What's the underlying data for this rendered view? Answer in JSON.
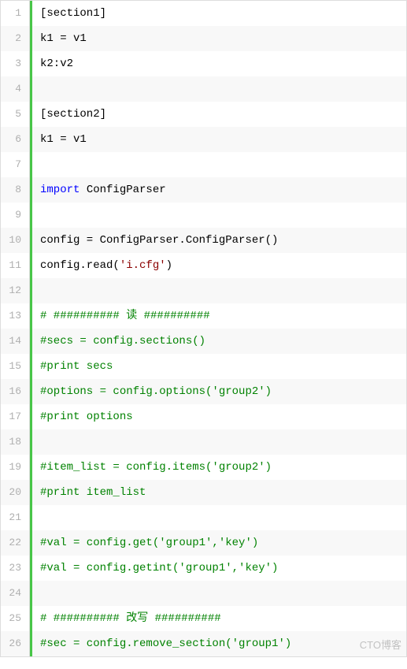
{
  "lines": [
    {
      "n": 1,
      "tokens": [
        {
          "cls": "plain",
          "t": "[section1]"
        }
      ]
    },
    {
      "n": 2,
      "tokens": [
        {
          "cls": "plain",
          "t": "k1 = v1"
        }
      ]
    },
    {
      "n": 3,
      "tokens": [
        {
          "cls": "plain",
          "t": "k2:v2"
        }
      ]
    },
    {
      "n": 4,
      "tokens": [
        {
          "cls": "plain",
          "t": ""
        }
      ]
    },
    {
      "n": 5,
      "tokens": [
        {
          "cls": "plain",
          "t": "[section2]"
        }
      ]
    },
    {
      "n": 6,
      "tokens": [
        {
          "cls": "plain",
          "t": "k1 = v1"
        }
      ]
    },
    {
      "n": 7,
      "tokens": [
        {
          "cls": "plain",
          "t": ""
        }
      ]
    },
    {
      "n": 8,
      "tokens": [
        {
          "cls": "tok-kw",
          "t": "import"
        },
        {
          "cls": "plain",
          "t": " ConfigParser"
        }
      ]
    },
    {
      "n": 9,
      "tokens": [
        {
          "cls": "plain",
          "t": ""
        }
      ]
    },
    {
      "n": 10,
      "tokens": [
        {
          "cls": "plain",
          "t": "config = ConfigParser.ConfigParser()"
        }
      ]
    },
    {
      "n": 11,
      "tokens": [
        {
          "cls": "plain",
          "t": "config.read("
        },
        {
          "cls": "tok-str",
          "t": "'i.cfg'"
        },
        {
          "cls": "plain",
          "t": ")"
        }
      ]
    },
    {
      "n": 12,
      "tokens": [
        {
          "cls": "plain",
          "t": ""
        }
      ]
    },
    {
      "n": 13,
      "tokens": [
        {
          "cls": "tok-comment",
          "t": "# ########## 读 ##########"
        }
      ]
    },
    {
      "n": 14,
      "tokens": [
        {
          "cls": "tok-comment",
          "t": "#secs = config.sections()"
        }
      ]
    },
    {
      "n": 15,
      "tokens": [
        {
          "cls": "tok-comment",
          "t": "#print secs"
        }
      ]
    },
    {
      "n": 16,
      "tokens": [
        {
          "cls": "tok-comment",
          "t": "#options = config.options('group2')"
        }
      ]
    },
    {
      "n": 17,
      "tokens": [
        {
          "cls": "tok-comment",
          "t": "#print options"
        }
      ]
    },
    {
      "n": 18,
      "tokens": [
        {
          "cls": "plain",
          "t": ""
        }
      ]
    },
    {
      "n": 19,
      "tokens": [
        {
          "cls": "tok-comment",
          "t": "#item_list = config.items('group2')"
        }
      ]
    },
    {
      "n": 20,
      "tokens": [
        {
          "cls": "tok-comment",
          "t": "#print item_list"
        }
      ]
    },
    {
      "n": 21,
      "tokens": [
        {
          "cls": "plain",
          "t": ""
        }
      ]
    },
    {
      "n": 22,
      "tokens": [
        {
          "cls": "tok-comment",
          "t": "#val = config.get('group1','key')"
        }
      ]
    },
    {
      "n": 23,
      "tokens": [
        {
          "cls": "tok-comment",
          "t": "#val = config.getint('group1','key')"
        }
      ]
    },
    {
      "n": 24,
      "tokens": [
        {
          "cls": "plain",
          "t": ""
        }
      ]
    },
    {
      "n": 25,
      "tokens": [
        {
          "cls": "tok-comment",
          "t": "# ########## 改写 ##########"
        }
      ]
    },
    {
      "n": 26,
      "tokens": [
        {
          "cls": "tok-comment",
          "t": "#sec = config.remove_section('group1')"
        }
      ]
    }
  ],
  "watermark": "CTO博客"
}
